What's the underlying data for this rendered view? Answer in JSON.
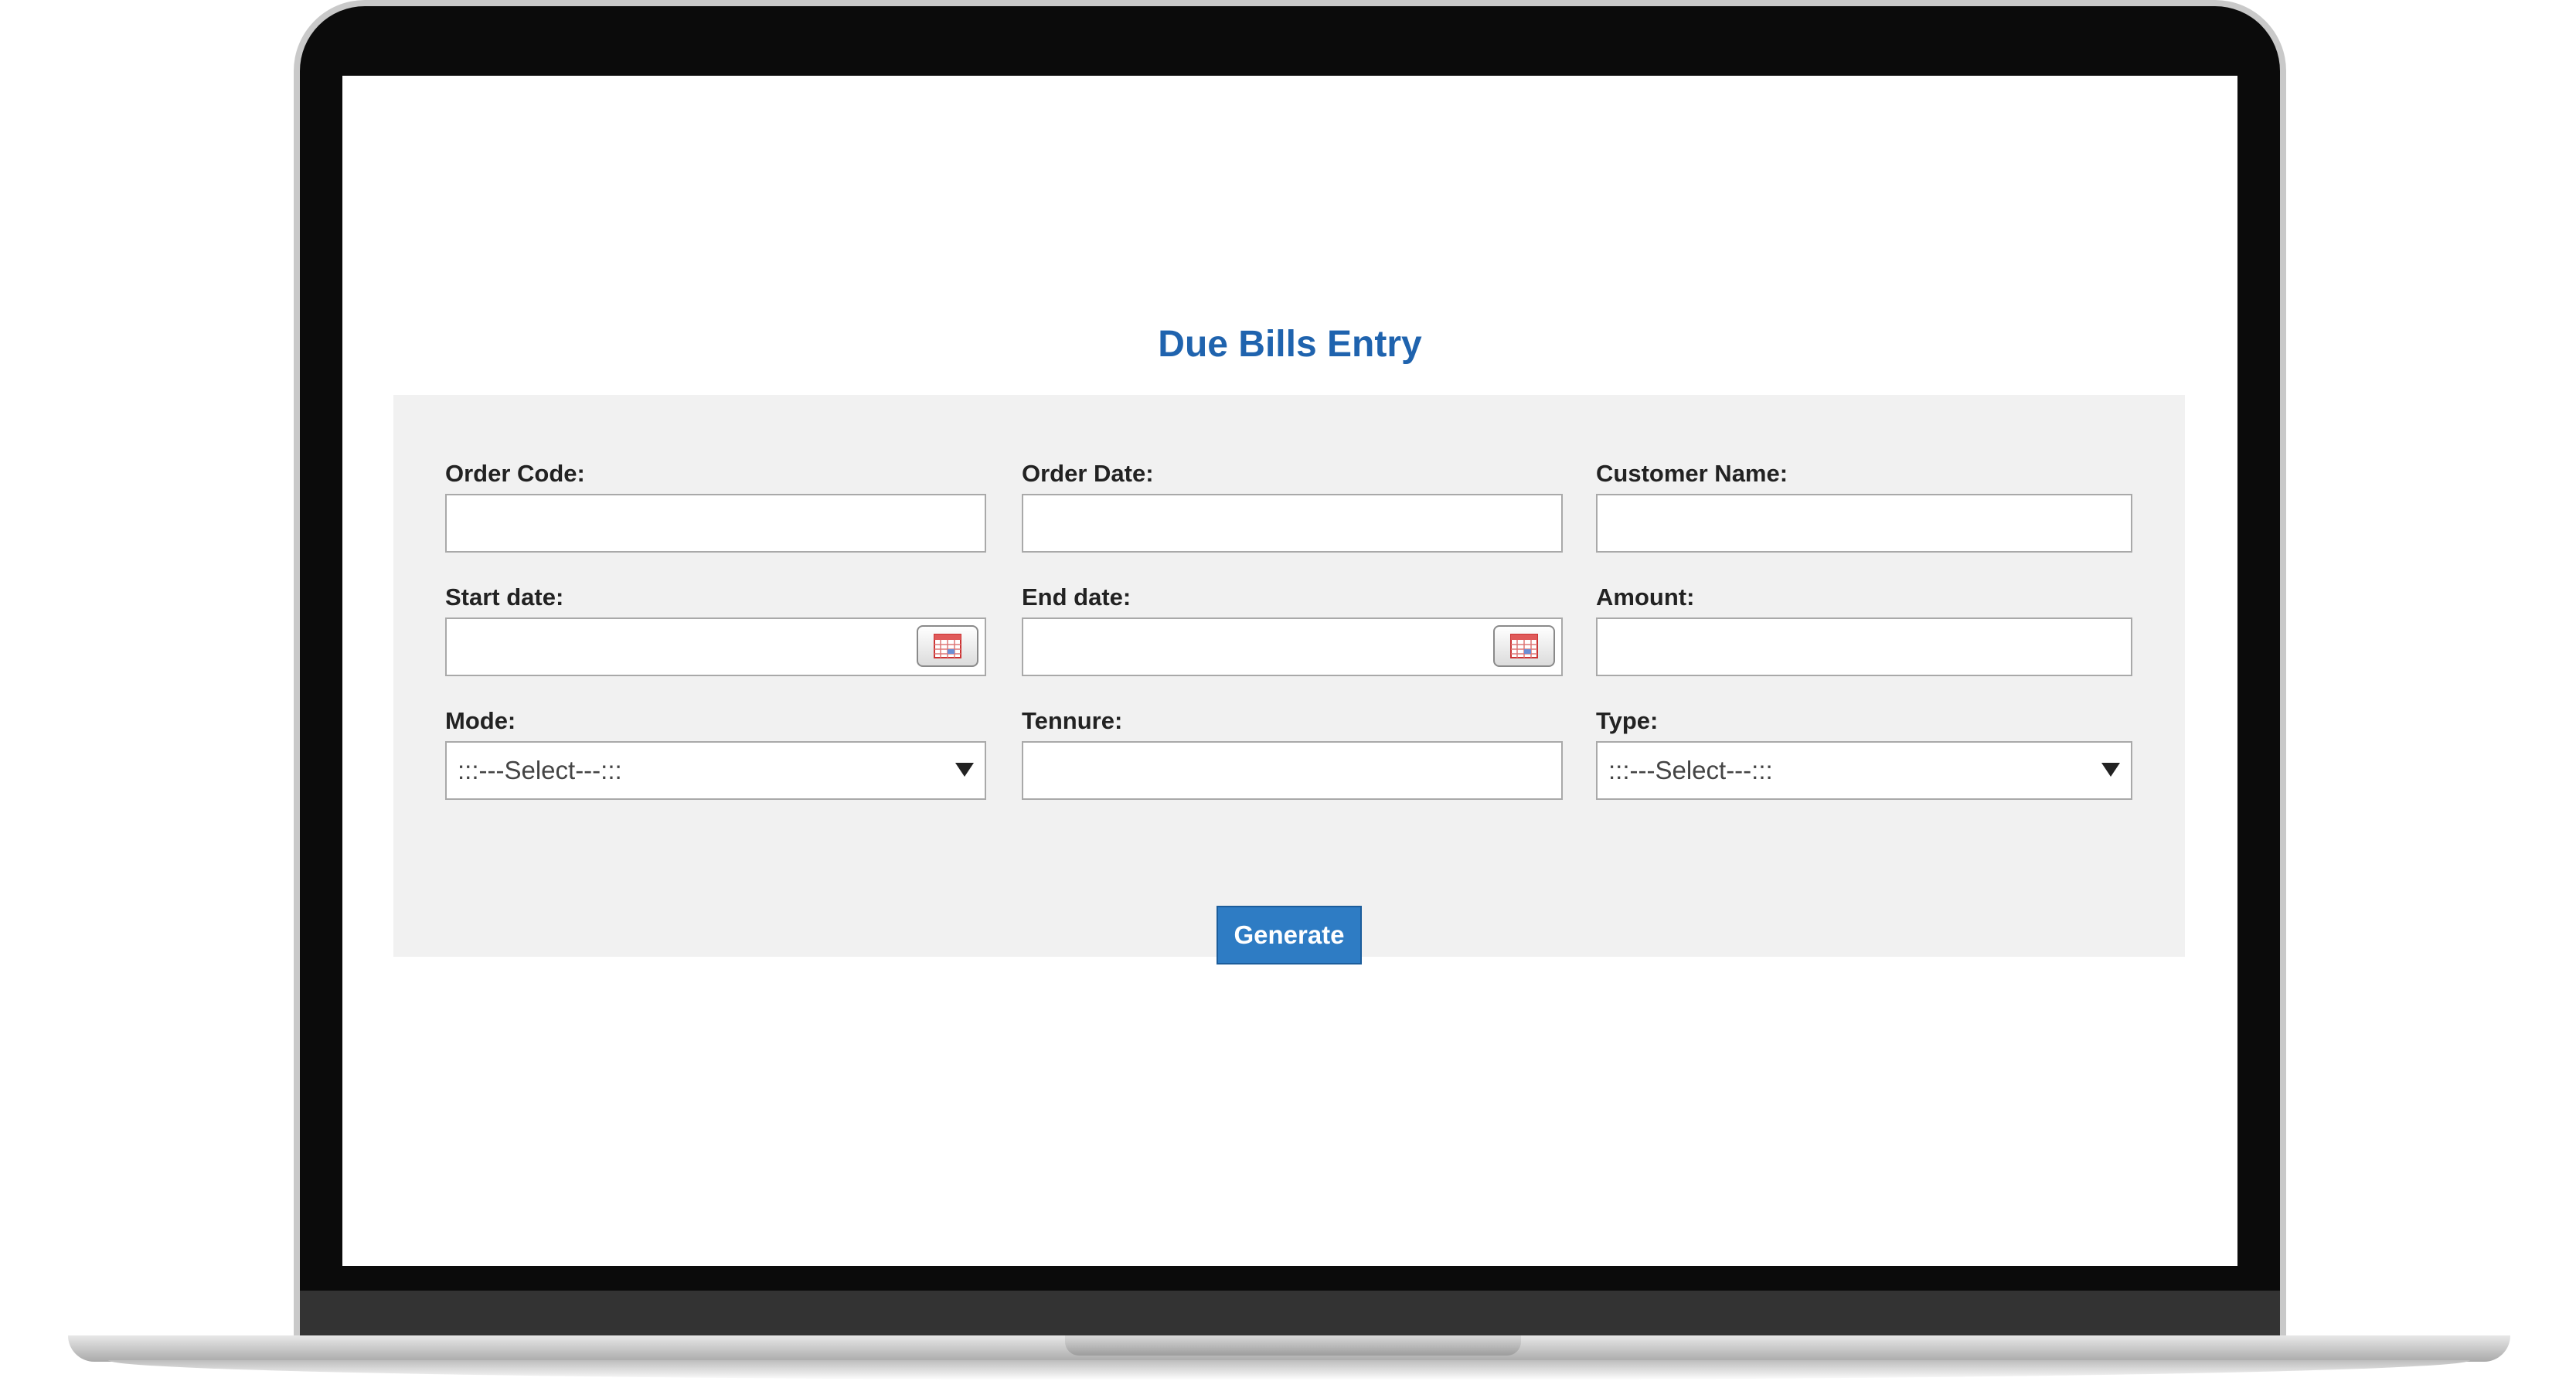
{
  "page": {
    "title": "Due Bills Entry"
  },
  "form": {
    "order_code": {
      "label": "Order Code:",
      "value": ""
    },
    "order_date": {
      "label": "Order Date:",
      "value": ""
    },
    "customer_name": {
      "label": "Customer Name:",
      "value": ""
    },
    "start_date": {
      "label": "Start date:",
      "value": "",
      "icon": "calendar-icon"
    },
    "end_date": {
      "label": "End date:",
      "value": "",
      "icon": "calendar-icon"
    },
    "amount": {
      "label": "Amount:",
      "value": ""
    },
    "mode": {
      "label": "Mode:",
      "selected": ":::---Select---:::"
    },
    "tennure": {
      "label": "Tennure:",
      "value": ""
    },
    "type": {
      "label": "Type:",
      "selected": ":::---Select---:::"
    },
    "generate_label": "Generate"
  },
  "colors": {
    "title": "#1f63ae",
    "button": "#2e7cc4",
    "panel": "#f1f1f1"
  }
}
